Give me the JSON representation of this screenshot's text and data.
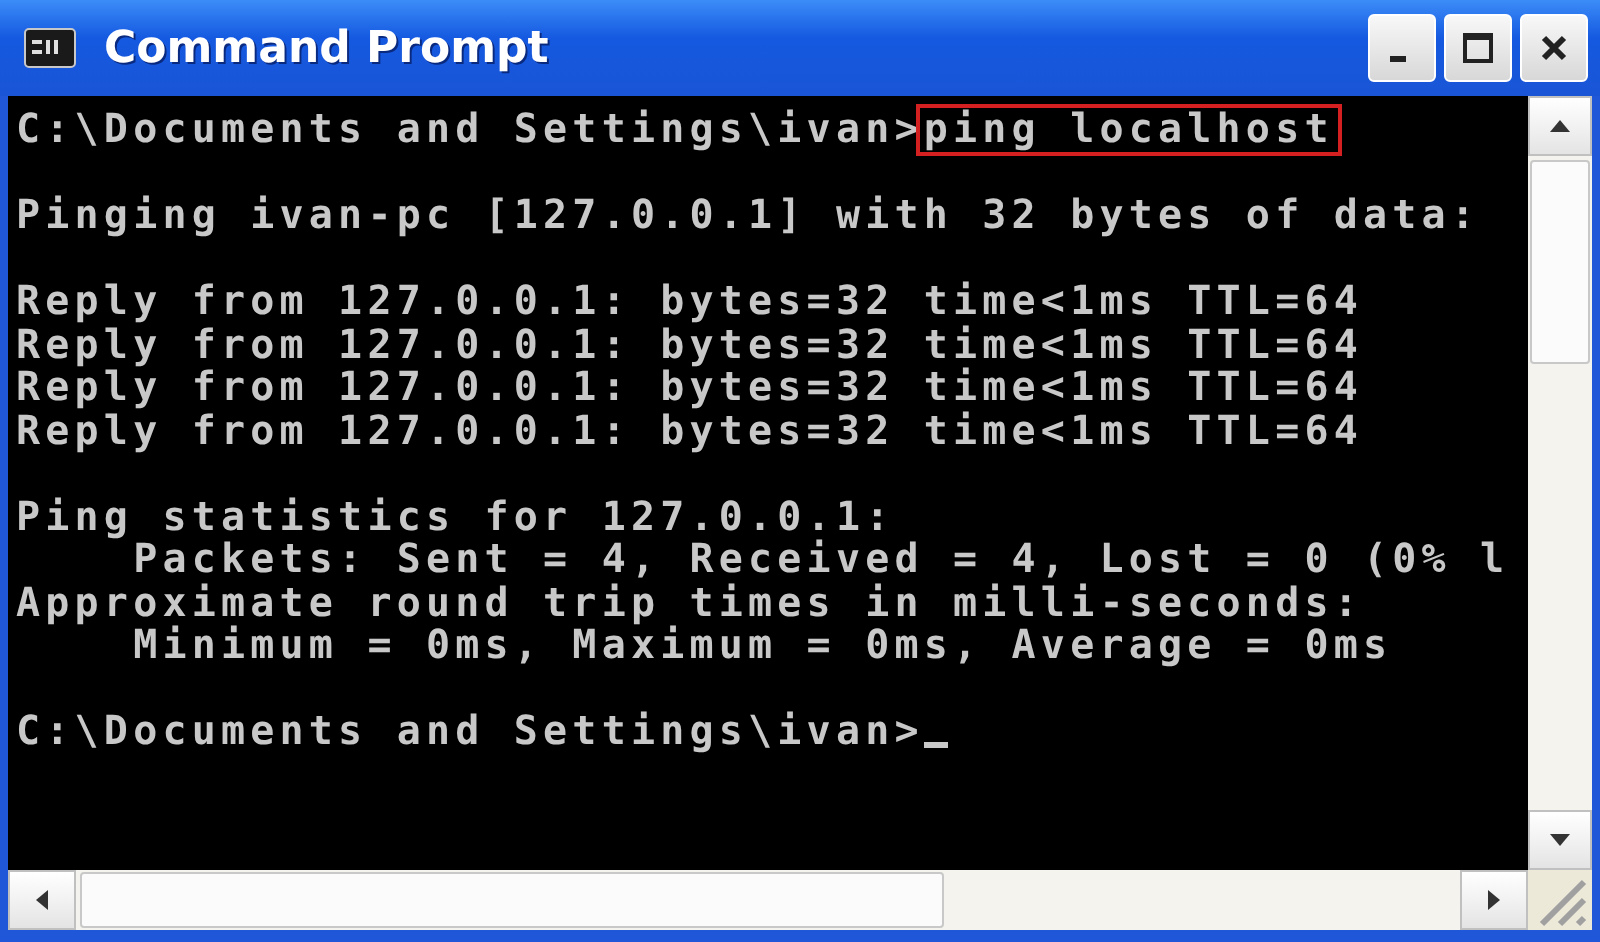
{
  "window": {
    "title": "Command Prompt"
  },
  "console": {
    "blocks": [
      [
        {
          "kind": "command",
          "prompt": "C:\\Documents and Settings\\ivan>",
          "command": "ping localhost",
          "highlighted": true
        }
      ],
      [
        {
          "kind": "output",
          "text": "Pinging ivan-pc [127.0.0.1] with 32 bytes of data:"
        }
      ],
      [
        {
          "kind": "output",
          "text": "Reply from 127.0.0.1: bytes=32 time<1ms TTL=64"
        },
        {
          "kind": "output",
          "text": "Reply from 127.0.0.1: bytes=32 time<1ms TTL=64"
        },
        {
          "kind": "output",
          "text": "Reply from 127.0.0.1: bytes=32 time<1ms TTL=64"
        },
        {
          "kind": "output",
          "text": "Reply from 127.0.0.1: bytes=32 time<1ms TTL=64"
        }
      ],
      [
        {
          "kind": "output",
          "text": "Ping statistics for 127.0.0.1:"
        },
        {
          "kind": "output",
          "text": "    Packets: Sent = 4, Received = 4, Lost = 0 (0% l"
        },
        {
          "kind": "output",
          "text": "Approximate round trip times in milli-seconds:"
        },
        {
          "kind": "output",
          "text": "    Minimum = 0ms, Maximum = 0ms, Average = 0ms"
        }
      ],
      [
        {
          "kind": "prompt",
          "prompt": "C:\\Documents and Settings\\ivan>",
          "cursor": true
        }
      ]
    ]
  }
}
